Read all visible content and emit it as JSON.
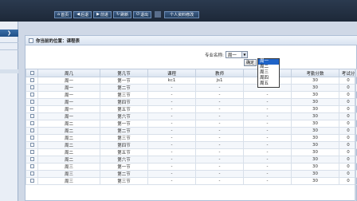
{
  "nav": {
    "buttons": [
      {
        "icon": "⌂",
        "label": "首页"
      },
      {
        "icon": "◀",
        "label": "后退"
      },
      {
        "icon": "▶",
        "label": "前进"
      },
      {
        "icon": "↻",
        "label": "刷新"
      },
      {
        "icon": "⏻",
        "label": "退出"
      }
    ],
    "personal_label": "个人资料修改"
  },
  "breadcrumb": {
    "text": "你当前的位置：课程表"
  },
  "filter": {
    "label": "专业名称:",
    "selected": "周一",
    "ok_label": "确定",
    "options": [
      "周一",
      "周二",
      "周三",
      "周四",
      "周五"
    ]
  },
  "table": {
    "headers": [
      "",
      "周几",
      "第几节",
      "课程",
      "教师",
      "教室",
      "考勤分数",
      "考试分"
    ],
    "rows": [
      [
        "周一",
        "第一节",
        "kc1",
        "js1",
        "jsmc1",
        "30",
        "0"
      ],
      [
        "周一",
        "第二节",
        "-",
        "-",
        "-",
        "30",
        "0"
      ],
      [
        "周一",
        "第三节",
        "-",
        "-",
        "-",
        "30",
        "0"
      ],
      [
        "周一",
        "第四节",
        "-",
        "-",
        "-",
        "30",
        "0"
      ],
      [
        "周一",
        "第五节",
        "-",
        "-",
        "-",
        "30",
        "0"
      ],
      [
        "周一",
        "第六节",
        "-",
        "-",
        "-",
        "30",
        "0"
      ],
      [
        "周二",
        "第一节",
        "-",
        "-",
        "-",
        "30",
        "0"
      ],
      [
        "周二",
        "第二节",
        "-",
        "-",
        "-",
        "30",
        "0"
      ],
      [
        "周二",
        "第三节",
        "-",
        "-",
        "-",
        "30",
        "0"
      ],
      [
        "周二",
        "第四节",
        "-",
        "-",
        "-",
        "30",
        "0"
      ],
      [
        "周二",
        "第五节",
        "-",
        "-",
        "-",
        "30",
        "0"
      ],
      [
        "周二",
        "第六节",
        "-",
        "-",
        "-",
        "30",
        "0"
      ],
      [
        "周三",
        "第一节",
        "-",
        "-",
        "-",
        "30",
        "0"
      ],
      [
        "周三",
        "第二节",
        "-",
        "-",
        "-",
        "30",
        "0"
      ],
      [
        "周三",
        "第三节",
        "-",
        "-",
        "-",
        "30",
        "0"
      ]
    ]
  }
}
